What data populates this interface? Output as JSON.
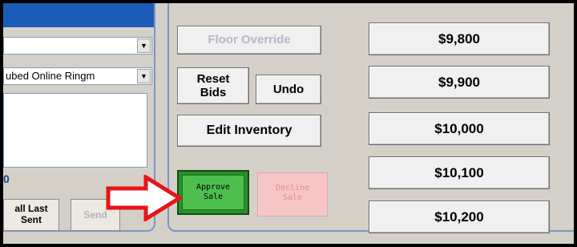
{
  "left_panel": {
    "combo1": {
      "value": "",
      "dropdown_icon": "chevron-down-icon"
    },
    "combo2": {
      "value": "ubed Online Ringm"
    },
    "blue_mark": "0",
    "recall_button": {
      "line1": "all Last",
      "line2": "Sent"
    },
    "send_button": "Send"
  },
  "controls": {
    "floor_override": "Floor Override",
    "reset_bids": {
      "line1": "Reset",
      "line2": "Bids"
    },
    "undo": "Undo",
    "edit_inventory": "Edit Inventory",
    "approve_sale": {
      "line1": "Approve",
      "line2": "Sale"
    },
    "decline_sale": {
      "line1": "Decline",
      "line2": "Sale"
    }
  },
  "prices": [
    "$9,800",
    "$9,900",
    "$10,000",
    "$10,100",
    "$10,200"
  ],
  "colors": {
    "header_blue": "#1c5bb8",
    "approve_green": "#4cbf4c",
    "decline_pink": "#f6c6c6",
    "arrow_red": "#e8141b"
  }
}
